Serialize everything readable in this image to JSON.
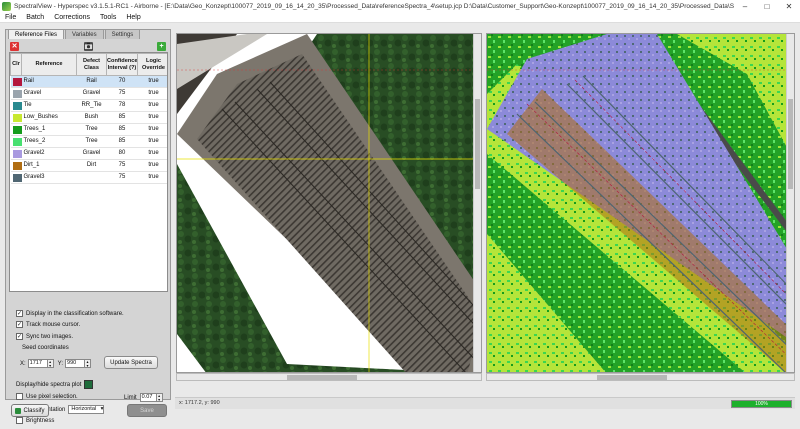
{
  "window": {
    "title": "SpectralView - Hyperspec v3.1.5.1-RC1 - Airborne - [E:\\Data\\Geo_Konzept\\100077_2019_09_16_14_20_35\\Processed_Data\\referenceSpectra_4\\setup.jcp D:\\Data\\Customer_Support\\Geo-Konzept\\100077_2019_09_16_14_20_35\\Processed_Data\\SE_Half_Full_Sc...",
    "minimize": "–",
    "maximize": "□",
    "close": "✕"
  },
  "menu": [
    "File",
    "Batch",
    "Corrections",
    "Tools",
    "Help"
  ],
  "tabs": [
    "Reference Files",
    "Variables",
    "Settings"
  ],
  "table": {
    "headers": [
      "Clr",
      "Reference",
      "Defect Class",
      "Confidence Interval (?)",
      "Logic Override"
    ],
    "rows": [
      {
        "color": "#b3173d",
        "reference": "Rail",
        "defect_class": "Rail",
        "confidence": "70",
        "logic": "true"
      },
      {
        "color": "#9aa4ad",
        "reference": "Gravel",
        "defect_class": "Gravel",
        "confidence": "75",
        "logic": "true"
      },
      {
        "color": "#2a8a90",
        "reference": "Tie",
        "defect_class": "RR_Tie",
        "confidence": "78",
        "logic": "true"
      },
      {
        "color": "#c8e830",
        "reference": "Low_Bushes",
        "defect_class": "Bush",
        "confidence": "85",
        "logic": "true"
      },
      {
        "color": "#169c1c",
        "reference": "Trees_1",
        "defect_class": "Tree",
        "confidence": "85",
        "logic": "true"
      },
      {
        "color": "#48e070",
        "reference": "Trees_2",
        "defect_class": "Tree",
        "confidence": "85",
        "logic": "true"
      },
      {
        "color": "#a99ae0",
        "reference": "Gravel2",
        "defect_class": "Gravel",
        "confidence": "80",
        "logic": "true"
      },
      {
        "color": "#b06d12",
        "reference": "Dirt_1",
        "defect_class": "Dirt",
        "confidence": "75",
        "logic": "true"
      },
      {
        "color": "#506773",
        "reference": "Gravel3",
        "defect_class": "",
        "confidence": "75",
        "logic": "true"
      }
    ]
  },
  "options": {
    "display_classification": "Display in the classification software.",
    "track_mouse": "Track mouse cursor.",
    "sync_images": "Sync two images.",
    "seed_label": "Seed coordinates",
    "x_label": "X:",
    "x_value": "1717",
    "y_label": "Y:",
    "y_value": "990",
    "update_spectra": "Update Spectra",
    "display_hide_plot": "Display/hide spectra plot",
    "use_pixel": "Use pixel selection.",
    "limit_label": "Limit",
    "limit_value": "0.07",
    "orientation_label": "Display orientation",
    "orientation_value": "Horizontal",
    "brightness": "Brightness",
    "check_mark": "✓"
  },
  "buttons": {
    "classify": "Classify",
    "save": "Save"
  },
  "status": {
    "coords": "x: 1717.2, y: 990",
    "progress": 100,
    "progress_text": "100%"
  },
  "colors": {
    "accent_green": "#1db02c"
  }
}
